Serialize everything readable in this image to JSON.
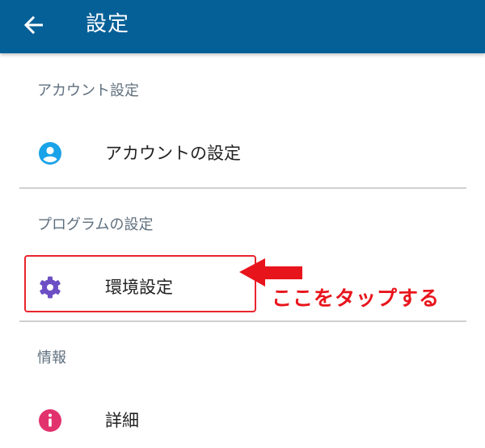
{
  "appbar": {
    "title": "設定",
    "bg_color": "#066098",
    "back_icon": "arrow-left-icon"
  },
  "sections": [
    {
      "header": "アカウント設定",
      "items": [
        {
          "label": "アカウントの設定",
          "icon": "account-circle-icon",
          "icon_color": "#1aa3e8"
        }
      ]
    },
    {
      "header": "プログラムの設定",
      "items": [
        {
          "label": "環境設定",
          "icon": "gear-icon",
          "icon_color": "#6c4fc4"
        }
      ]
    },
    {
      "header": "情報",
      "items": [
        {
          "label": "詳細",
          "icon": "info-icon",
          "icon_color": "#e2326e"
        }
      ]
    }
  ],
  "annotation": {
    "text": "ここをタップする",
    "color": "#e8141c"
  }
}
